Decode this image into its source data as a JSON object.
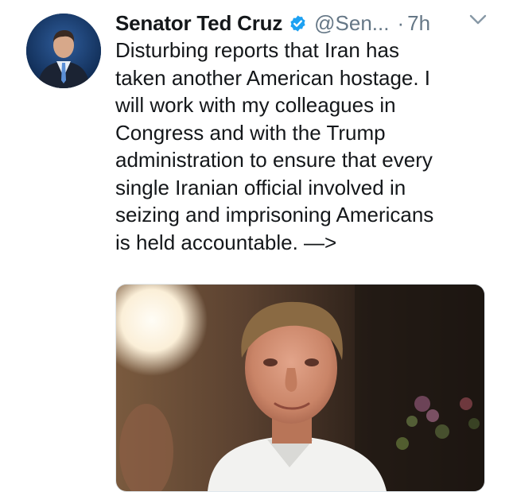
{
  "tweet": {
    "display_name": "Senator Ted Cruz",
    "handle": "@Sen...",
    "separator": "·",
    "time": "7h",
    "verified": true,
    "icons": {
      "verified": "verified-badge-icon",
      "menu": "chevron-down-icon"
    },
    "text_lines": [
      "Disturbing reports that Iran has",
      "taken another American hostage. I",
      "will work with my colleagues in",
      "Congress and with the Trump",
      "administration to ensure that every",
      "single Iranian official involved in",
      "seizing and imprisoning Americans",
      "is held accountable. —>"
    ]
  },
  "colors": {
    "name": "#14171a",
    "secondary": "#657786",
    "verified": "#1da1f2"
  }
}
